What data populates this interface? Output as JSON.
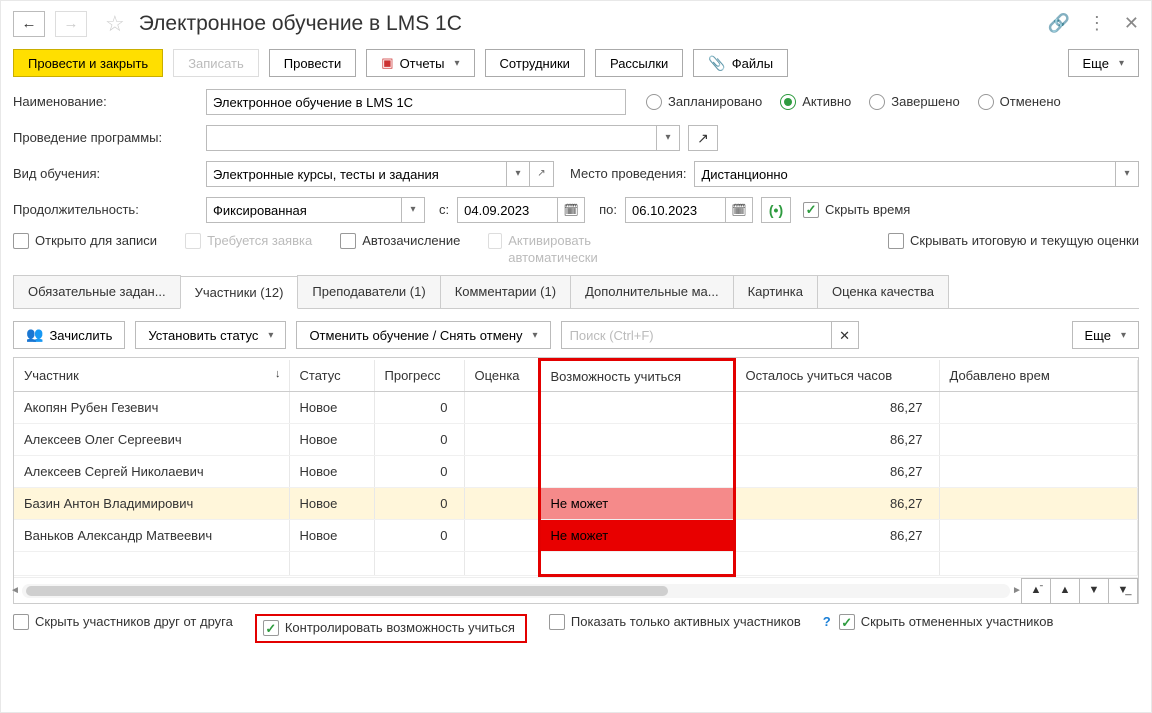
{
  "titlebar": {
    "title": "Электронное обучение в LMS 1С"
  },
  "toolbar": {
    "post_close": "Провести и закрыть",
    "save": "Записать",
    "post": "Провести",
    "reports": "Отчеты",
    "employees": "Сотрудники",
    "mailings": "Рассылки",
    "files": "Файлы",
    "more": "Еще"
  },
  "form": {
    "name_label": "Наименование:",
    "name_value": "Электронное обучение в LMS 1С",
    "status": {
      "planned": "Запланировано",
      "active": "Активно",
      "completed": "Завершено",
      "cancelled": "Отменено"
    },
    "program_label": "Проведение программы:",
    "program_value": "",
    "type_label": "Вид обучения:",
    "type_value": "Электронные курсы, тесты и задания",
    "location_label": "Место проведения:",
    "location_value": "Дистанционно",
    "duration_label": "Продолжительность:",
    "duration_value": "Фиксированная",
    "from_label": "с:",
    "from_value": "04.09.2023",
    "to_label": "по:",
    "to_value": "06.10.2023",
    "hide_time": "Скрыть время",
    "checks": {
      "open_signup": "Открыто для записи",
      "needs_request": "Требуется заявка",
      "auto_enroll": "Автозачисление",
      "auto_activate": "Активировать автоматически",
      "hide_grades": "Скрывать итоговую и текущую оценки"
    }
  },
  "tabs": {
    "mandatory": "Обязательные задан...",
    "participants": "Участники (12)",
    "teachers": "Преподаватели (1)",
    "comments": "Комментарии (1)",
    "materials": "Дополнительные ма...",
    "image": "Картинка",
    "quality": "Оценка качества"
  },
  "tab_toolbar": {
    "enroll": "Зачислить",
    "set_status": "Установить статус",
    "cancel_training": "Отменить обучение / Снять отмену",
    "search_placeholder": "Поиск (Ctrl+F)",
    "more": "Еще"
  },
  "table": {
    "cols": {
      "participant": "Участник",
      "status": "Статус",
      "progress": "Прогресс",
      "grade": "Оценка",
      "ability": "Возможность учиться",
      "hours_left": "Осталось учиться часов",
      "added_time": "Добавлено врем"
    },
    "rows": [
      {
        "participant": "Акопян Рубен Гезевич",
        "status": "Новое",
        "progress": "0",
        "grade": "",
        "ability": "",
        "hours": "86,27"
      },
      {
        "participant": "Алексеев Олег Сергеевич",
        "status": "Новое",
        "progress": "0",
        "grade": "",
        "ability": "",
        "hours": "86,27"
      },
      {
        "participant": "Алексеев Сергей Николаевич",
        "status": "Новое",
        "progress": "0",
        "grade": "",
        "ability": "",
        "hours": "86,27"
      },
      {
        "participant": "Базин Антон Владимирович",
        "status": "Новое",
        "progress": "0",
        "grade": "",
        "ability": "Не может",
        "hours": "86,27"
      },
      {
        "participant": "Ваньков Александр Матвеевич",
        "status": "Новое",
        "progress": "0",
        "grade": "",
        "ability": "Не может",
        "hours": "86,27"
      }
    ]
  },
  "footer": {
    "hide_from_each_other": "Скрыть участников друг от друга",
    "control_ability": "Контролировать возможность учиться",
    "show_active_only": "Показать только активных участников",
    "hide_cancelled": "Скрыть отмененных участников"
  }
}
